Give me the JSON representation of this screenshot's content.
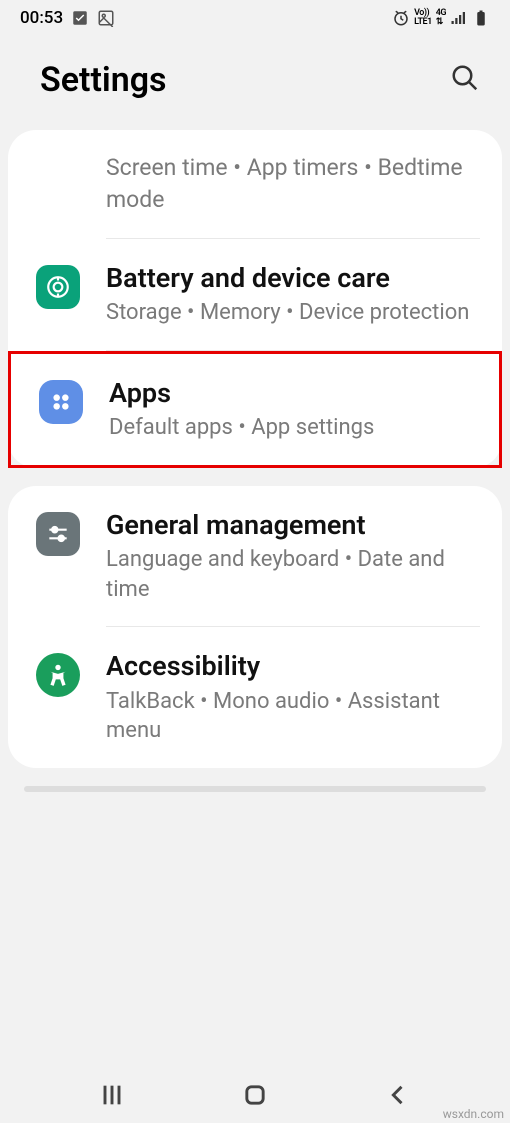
{
  "status": {
    "time": "00:53",
    "network": "Vo)) 4G LTE1",
    "icons": [
      "checkbox",
      "image",
      "alarm",
      "volte",
      "signal",
      "battery"
    ]
  },
  "header": {
    "title": "Settings"
  },
  "card1": {
    "item0_sub": "Screen time  •  App timers  •  Bedtime mode",
    "item1_title": "Battery and device care",
    "item1_sub": "Storage  •  Memory  •  Device protection",
    "item2_title": "Apps",
    "item2_sub": "Default apps  •  App settings"
  },
  "card2": {
    "item0_title": "General management",
    "item0_sub": "Language and keyboard  •  Date and time",
    "item1_title": "Accessibility",
    "item1_sub": "TalkBack  •  Mono audio  •  Assistant menu"
  },
  "colors": {
    "battery_icon": "#0aa27a",
    "apps_icon": "#5f8fe6",
    "general_icon": "#6a7579",
    "accessibility_icon": "#1a9e5c"
  },
  "watermark": "wsxdn.com"
}
